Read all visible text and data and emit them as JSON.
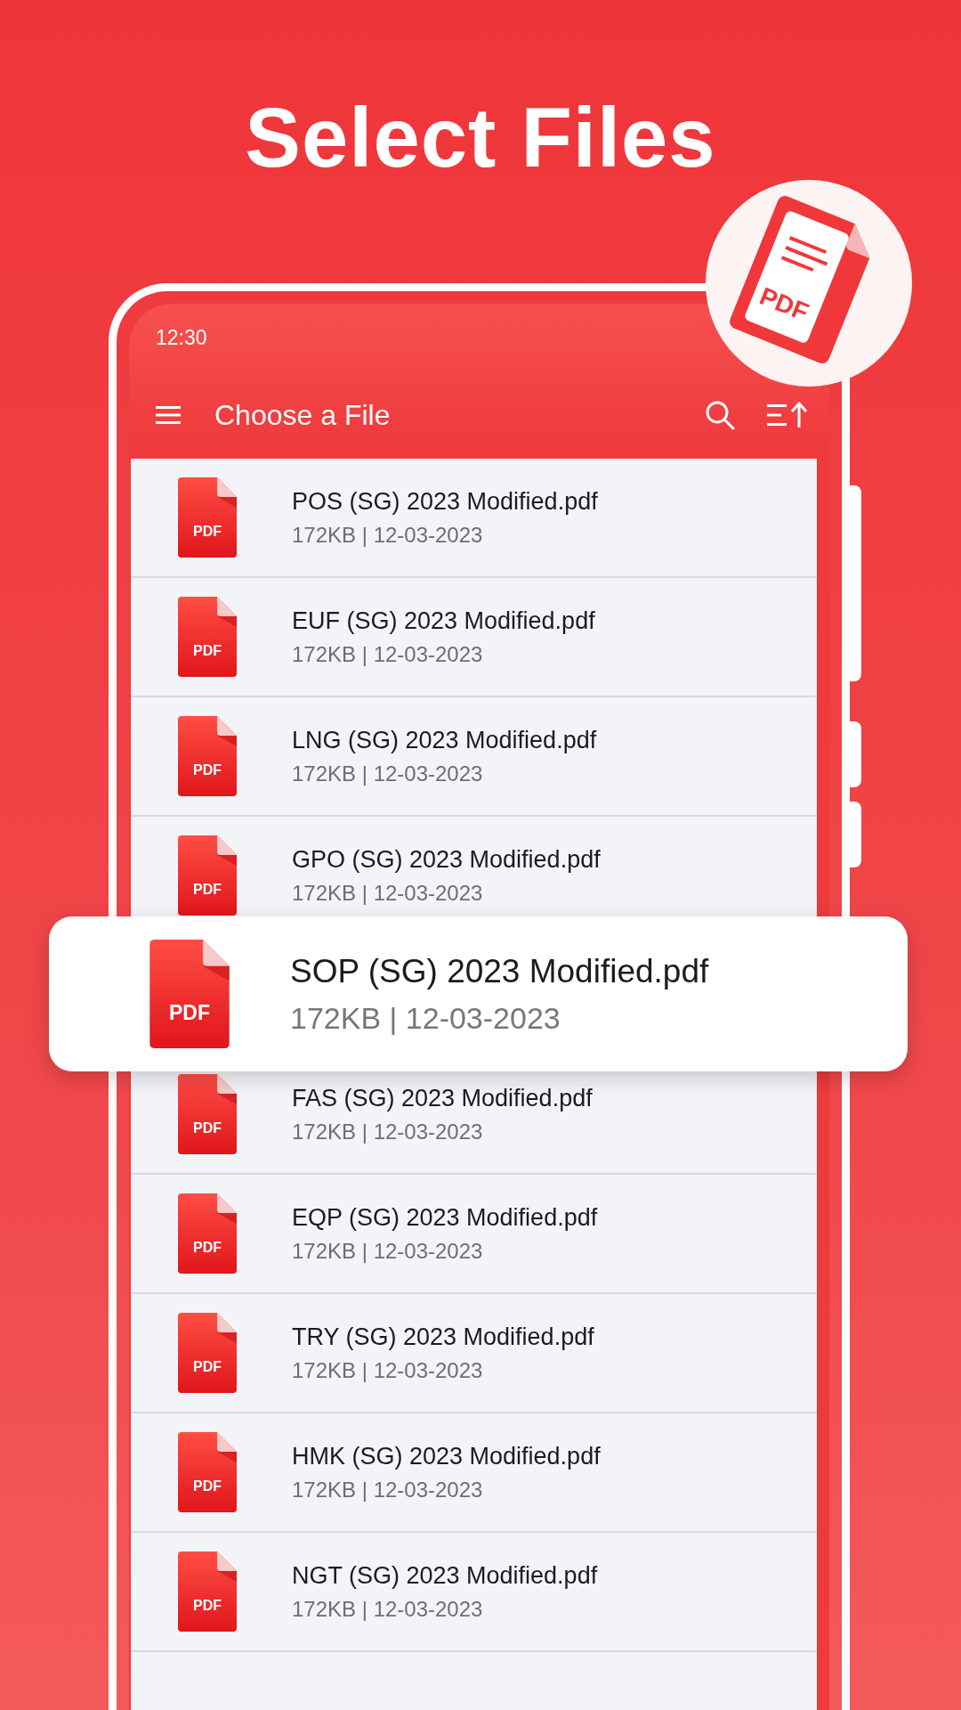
{
  "headline": "Select Files",
  "badge": {
    "label": "PDF"
  },
  "status_bar": {
    "time": "12:30"
  },
  "app_bar": {
    "title": "Choose a File"
  },
  "files_above": [
    {
      "name": "POS (SG) 2023 Modified.pdf",
      "meta": "172KB | 12-03-2023",
      "icon_label": "PDF"
    },
    {
      "name": "EUF (SG) 2023 Modified.pdf",
      "meta": "172KB | 12-03-2023",
      "icon_label": "PDF"
    },
    {
      "name": "LNG (SG) 2023 Modified.pdf",
      "meta": "172KB | 12-03-2023",
      "icon_label": "PDF"
    },
    {
      "name": "GPO (SG) 2023 Modified.pdf",
      "meta": "172KB | 12-03-2023",
      "icon_label": "PDF"
    }
  ],
  "highlighted_file": {
    "name": "SOP (SG) 2023 Modified.pdf",
    "meta": "172KB | 12-03-2023",
    "icon_label": "PDF"
  },
  "files_below": [
    {
      "name": "FAS (SG) 2023 Modified.pdf",
      "meta": "172KB | 12-03-2023",
      "icon_label": "PDF"
    },
    {
      "name": "EQP (SG) 2023 Modified.pdf",
      "meta": "172KB | 12-03-2023",
      "icon_label": "PDF"
    },
    {
      "name": "TRY (SG) 2023 Modified.pdf",
      "meta": "172KB | 12-03-2023",
      "icon_label": "PDF"
    },
    {
      "name": "HMK (SG) 2023 Modified.pdf",
      "meta": "172KB | 12-03-2023",
      "icon_label": "PDF"
    },
    {
      "name": "NGT (SG) 2023 Modified.pdf",
      "meta": "172KB | 12-03-2023",
      "icon_label": "PDF"
    }
  ]
}
